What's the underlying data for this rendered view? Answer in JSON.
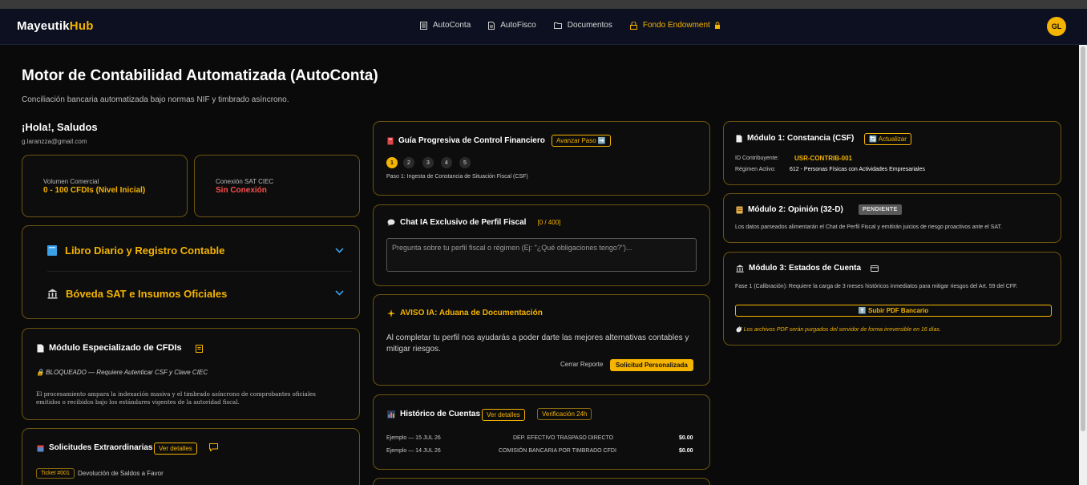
{
  "nav": {
    "brand_main": "Mayeutik",
    "brand_accent": "Hub",
    "links": [
      "AutoConta",
      "AutoFisco",
      "Documentos",
      "Fondo Endowment"
    ],
    "avatar": "GL"
  },
  "header": {
    "title": "Motor de Contabilidad Automatizada (AutoConta)",
    "subtitle": "Conciliación bancaria automatizada bajo normas NIF y timbrado asíncrono."
  },
  "user": {
    "greeting": "¡Hola!, Saludos",
    "email": "g.laranzza@gmail.com"
  },
  "stats": {
    "volume_label": "Volumen Comercial",
    "volume_value": "0 - 100 CFDIs (Nivel Inicial)",
    "sat_label": "Conexión SAT CIEC",
    "sat_value": "Sin Conexión"
  },
  "accordion": {
    "item1": "Libro Diario y Registro Contable",
    "item2": "Bóveda SAT e Insumos Oficiales"
  },
  "cfdi": {
    "title": "Módulo Especializado de CFDIs",
    "locked": "🔒 BLOQUEADO — Requiere Autenticar CSF y Clave CIEC",
    "desc": "El procesamiento ampara la indexación masiva y el timbrado asíncrono de comprobantes oficiales emitidos o recibidos bajo los estándares vigentes de la autoridad fiscal."
  },
  "solicitudes": {
    "title": "Solicitudes Extraordinarias",
    "btn": "Ver detalles",
    "ticket": "Ticket #001",
    "ticket_desc": "Devolución de Saldos a Favor"
  },
  "guia": {
    "title": "Guía Progresiva de Control Financiero",
    "btn": "Avanzar Paso ➡️",
    "steps": [
      "1",
      "2",
      "3",
      "4",
      "5"
    ],
    "step_desc": "Paso 1: Ingesta de Constancia de Situación Fiscal (CSF)"
  },
  "chat": {
    "title": "Chat IA Exclusivo de Perfil Fiscal",
    "counter": "[0 / 400]",
    "placeholder": "Pregunta sobre tu perfil fiscal o régimen (Ej: \"¿Qué obligaciones tengo?\")..."
  },
  "aviso": {
    "title": "AVISO IA: Aduana de Documentación",
    "body": "Al completar tu perfil nos ayudarás a poder darte las mejores alternativas contables y mitigar riesgos.",
    "close": "Cerrar Reporte",
    "btn": "Solicitud Personalizada"
  },
  "historico": {
    "title": "Histórico de Cuentas",
    "btn": "Ver detalles",
    "badge": "Verificación 24h",
    "rows": [
      {
        "fecha": "Ejemplo — 15 JUL 26",
        "concepto": "DEP. EFECTIVO TRASPASO DIRECTO",
        "monto": "$0.00"
      },
      {
        "fecha": "Ejemplo — 14 JUL 26",
        "concepto": "COMISIÓN BANCARIA POR TIMBRADO CFDI",
        "monto": "$0.00"
      }
    ]
  },
  "mod1": {
    "title": "Módulo 1: Constancia (CSF)",
    "btn": "🔄 Actualizar",
    "id_label": "ID Contribuyente:",
    "id_value": "USR-CONTRIB-001",
    "regimen_label": "Régimen Activo:",
    "regimen_value": "612 - Personas Físicas con Actividades Empresariales"
  },
  "mod2": {
    "title": "Módulo 2: Opinión (32-D)",
    "badge": "PENDIENTE",
    "desc": "Los datos parseados alimentarán el Chat de Perfil Fiscal y emitirán juicios de riesgo proactivos ante el SAT."
  },
  "mod3": {
    "title": "Módulo 3: Estados de Cuenta",
    "desc": "Fase 1 (Calibración): Requiere la carga de 3 meses históricos inmediatos para mitigar riesgos del Art. 59 del CFF.",
    "btn": "⬆️ Subir PDF Bancario",
    "note": "⏱️ Los archivos PDF serán purgados del servidor de forma irreversible en 16 días."
  },
  "colors": {
    "accent": "#f5b400",
    "danger": "#ff4d4d",
    "border": "#6b5410",
    "background": "#0a0a0a"
  }
}
